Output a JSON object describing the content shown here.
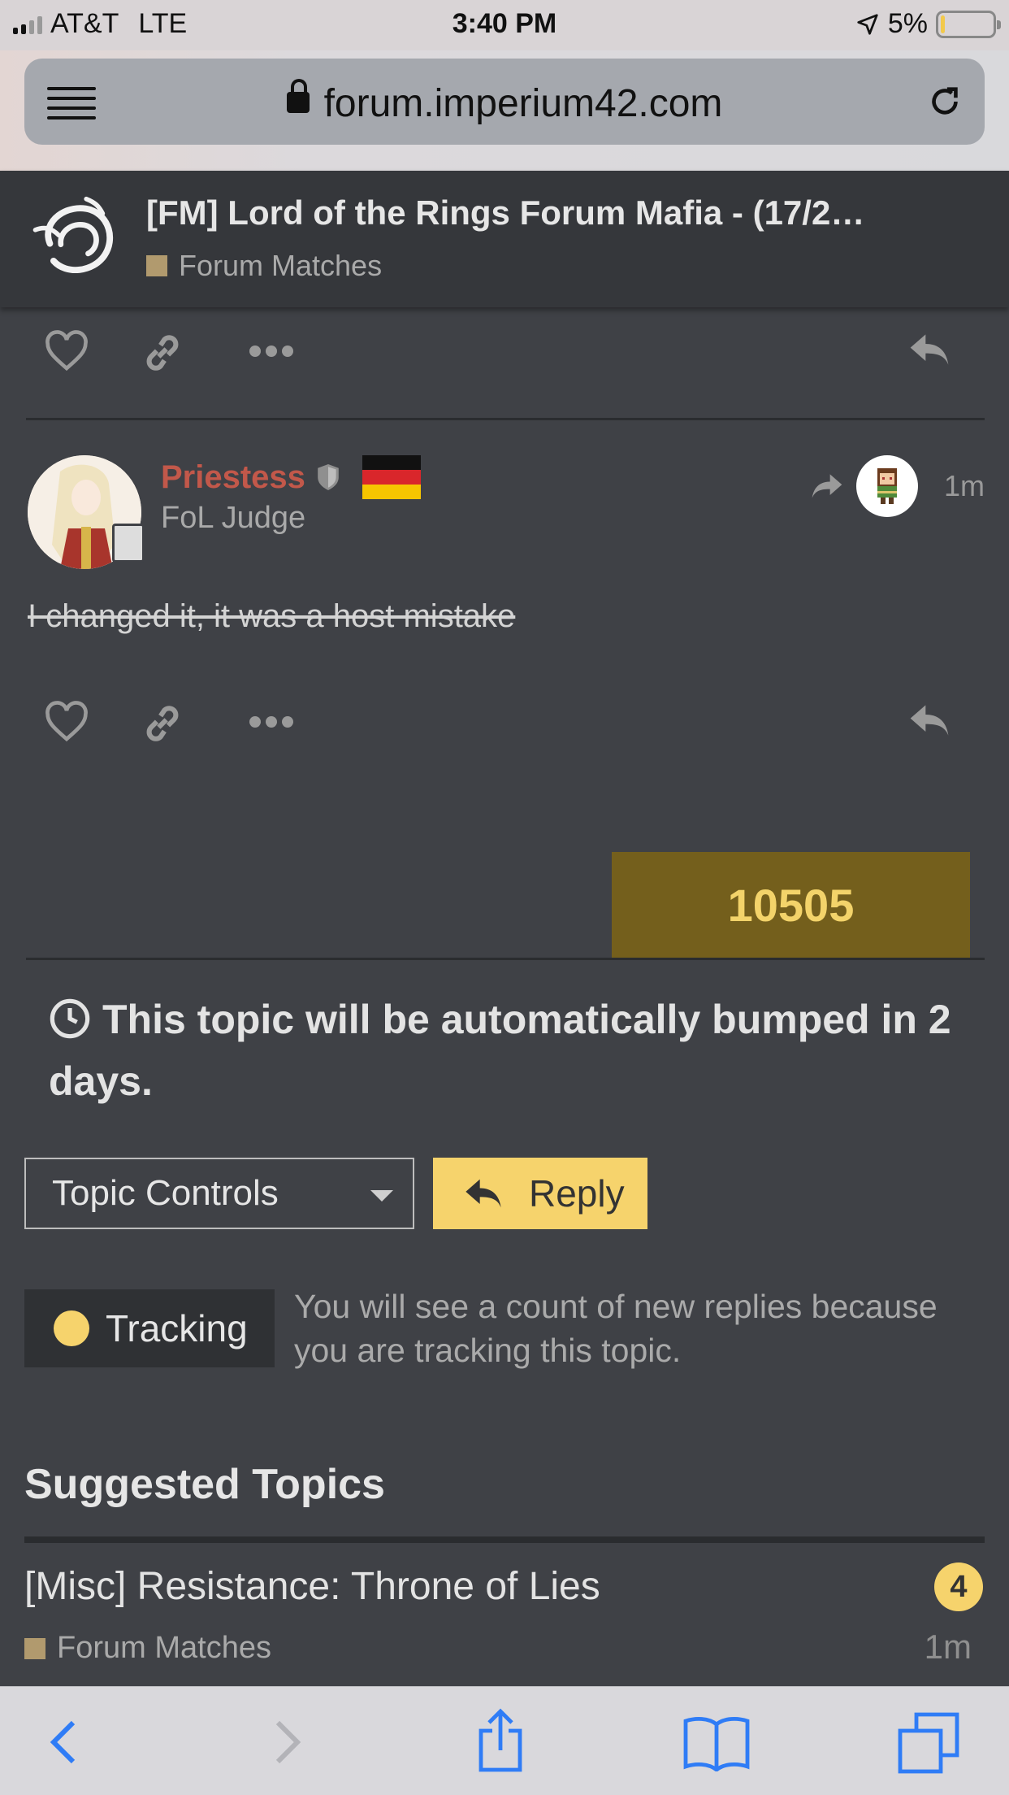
{
  "status_bar": {
    "carrier": "AT&T",
    "network": "LTE",
    "time": "3:40 PM",
    "battery": "5%",
    "battery_level": 0.05
  },
  "browser": {
    "url": "forum.imperium42.com"
  },
  "topic": {
    "title": "[FM] Lord of the Rings Forum Mafia - (17/2…",
    "category": "Forum Matches",
    "category_color": "#b19a6e"
  },
  "post": {
    "username": "Priestess",
    "user_title": "FoL Judge",
    "time_ago": "1m",
    "body": "I changed it, it was a host mistake"
  },
  "counter": {
    "value": "10505"
  },
  "bump": {
    "text": "This topic will be automatically bumped in 2 days."
  },
  "controls": {
    "topic_controls_label": "Topic Controls",
    "reply_label": "Reply"
  },
  "tracking": {
    "label": "Tracking",
    "description": "You will see a count of new replies because you are tracking this topic."
  },
  "suggested": {
    "heading": "Suggested Topics",
    "items": [
      {
        "title": "[Misc] Resistance: Throne of Lies",
        "count": "4",
        "category": "Forum Matches",
        "time": "1m"
      }
    ]
  },
  "colors": {
    "accent": "#f6d36c",
    "username": "#c2584a",
    "background": "#3f4146",
    "counter_bg": "#745f1c"
  }
}
